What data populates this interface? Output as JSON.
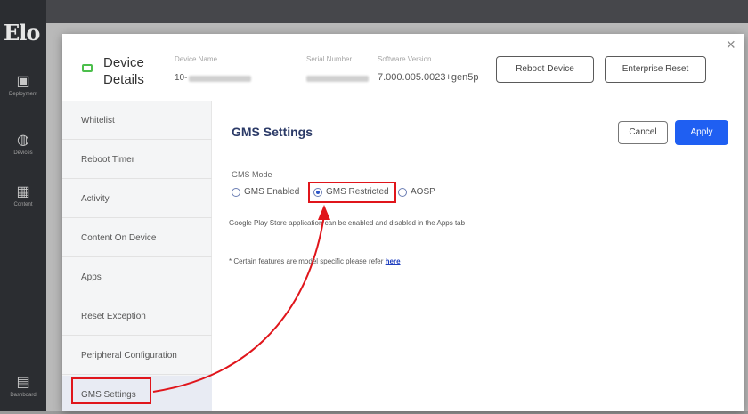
{
  "app": {
    "logo": "Elo",
    "rail": [
      {
        "icon": "device-icon",
        "caption": "Deployment"
      },
      {
        "icon": "chat-icon",
        "caption": "Devices"
      },
      {
        "icon": "grid-icon",
        "caption": "Content"
      },
      {
        "icon": "dashboard-icon",
        "caption": "Dashboard"
      }
    ]
  },
  "modal": {
    "title_line1": "Device",
    "title_line2": "Details",
    "device_name_label": "Device Name",
    "device_name_value": "10-",
    "serial_number_label": "Serial Number",
    "software_version_label": "Software Version",
    "software_version_value": "7.000.005.0023+gen5p",
    "reboot_button": "Reboot Device",
    "enterprise_reset_button": "Enterprise Reset",
    "close": "×"
  },
  "sidebar": {
    "items": [
      {
        "label": "Whitelist"
      },
      {
        "label": "Reboot Timer"
      },
      {
        "label": "Activity"
      },
      {
        "label": "Content On Device"
      },
      {
        "label": "Apps"
      },
      {
        "label": "Reset Exception"
      },
      {
        "label": "Peripheral Configuration"
      },
      {
        "label": "GMS Settings"
      }
    ],
    "active_index": 7
  },
  "content": {
    "title": "GMS Settings",
    "cancel_button": "Cancel",
    "apply_button": "Apply",
    "gms_mode_label": "GMS Mode",
    "options": [
      {
        "label": "GMS Enabled",
        "checked": false
      },
      {
        "label": "GMS Restricted",
        "checked": true
      },
      {
        "label": "AOSP",
        "checked": false
      }
    ],
    "info_text": "Google Play Store application can be enabled and disabled in the Apps tab",
    "note_text": "* Certain features are model specific please refer",
    "note_link": "here"
  },
  "colors": {
    "accent": "#1f5ff2",
    "annotation": "#e0151b",
    "title": "#2b3a67"
  }
}
